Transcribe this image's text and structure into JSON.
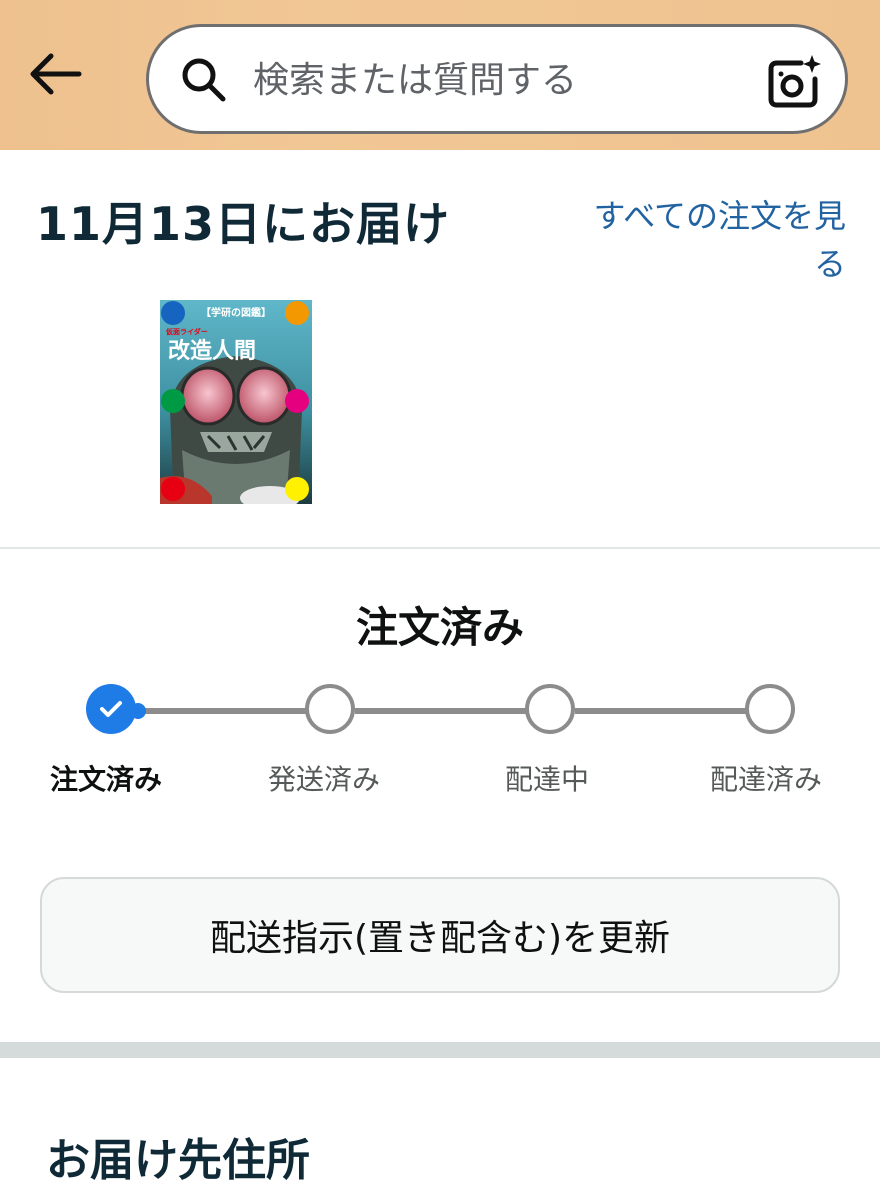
{
  "header": {
    "search_placeholder": "検索または質問する"
  },
  "delivery": {
    "title": "11月13日にお届け",
    "all_orders_link": "すべての注文を見る"
  },
  "book": {
    "series_label": "【学研の図鑑】",
    "brand_text": "仮面ライダー",
    "title_text": "改造人間",
    "dot_colors": [
      "#1565c0",
      "#f39800",
      "#009944",
      "#e4007f",
      "#e60012",
      "#fff100"
    ]
  },
  "status": {
    "title": "注文済み",
    "steps": [
      {
        "label": "注文済み",
        "state": "done"
      },
      {
        "label": "発送済み",
        "state": "pending"
      },
      {
        "label": "配達中",
        "state": "pending"
      },
      {
        "label": "配達済み",
        "state": "pending"
      }
    ],
    "progress_completed_steps": 1
  },
  "actions": {
    "update_instructions_label": "配送指示(置き配含む)を更新"
  },
  "address": {
    "title": "お届け先住所"
  },
  "colors": {
    "header_bg": "#f0c592",
    "link": "#2162a1",
    "step_done": "#1f7be6",
    "step_pending": "#8c8c8c"
  }
}
